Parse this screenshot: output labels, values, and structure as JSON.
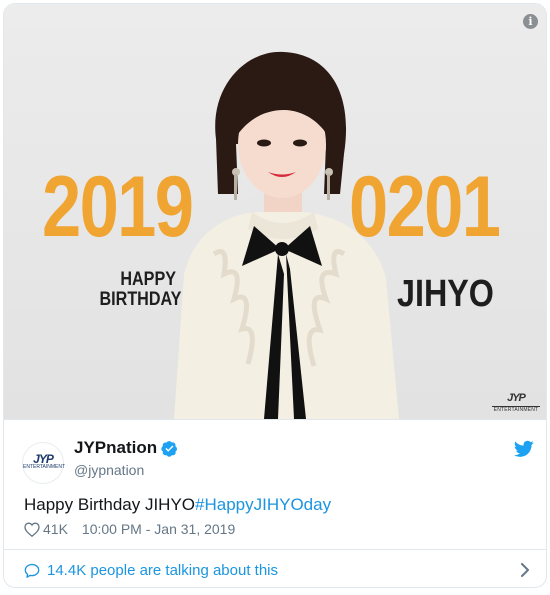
{
  "media": {
    "year_text": "2019",
    "date_text": "0201",
    "happy_line1": "HAPPY",
    "happy_line2": "BIRTHDAY",
    "name_text": "JIHYO",
    "info_icon": "info-icon",
    "watermark_icon": "jyp-entertainment-logo"
  },
  "tweet": {
    "display_name": "JYPnation",
    "handle": "@jypnation",
    "verified_icon": "verified-badge-icon",
    "bird_icon": "twitter-bird-icon",
    "text_plain": "Happy Birthday JIHYO",
    "hashtag": "#HappyJIHYOday",
    "likes": "41K",
    "timestamp": "10:00 PM - Jan 31, 2019",
    "heart_icon": "heart-icon"
  },
  "footer": {
    "talking_text": "14.4K people are talking about this",
    "bubble_icon": "speech-bubble-icon",
    "chevron_icon": "chevron-right-icon"
  },
  "colors": {
    "accent_blue": "#1b95e0",
    "number_orange": "#f0a431",
    "muted_text": "#657786",
    "border": "#e1e8ed"
  }
}
